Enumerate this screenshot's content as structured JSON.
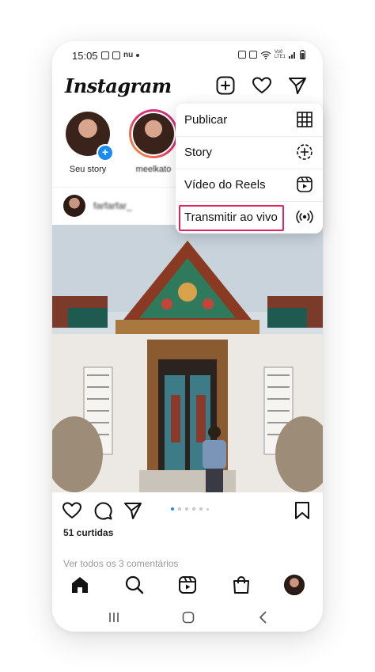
{
  "status_bar": {
    "time": "15:05",
    "carrier": "Vo0 LTE1"
  },
  "header": {
    "logo": "Instagram",
    "icons": [
      "new-post-icon",
      "heart-icon",
      "direct-message-icon"
    ]
  },
  "stories": [
    {
      "label": "Seu story"
    },
    {
      "label": "meelkato"
    }
  ],
  "post": {
    "username": "farfarfar_",
    "likes": "51 curtidas",
    "comments_link": "Ver todos os 3 comentários",
    "carousel": {
      "count": 6,
      "active": 1
    }
  },
  "menu": {
    "items": [
      {
        "label": "Publicar",
        "icon": "grid-icon"
      },
      {
        "label": "Story",
        "icon": "story-add-icon"
      },
      {
        "label": "Vídeo do Reels",
        "icon": "reels-icon"
      },
      {
        "label": "Transmitir ao vivo",
        "icon": "live-broadcast-icon"
      }
    ],
    "highlight_color": "#e0245e"
  },
  "bottom_nav": [
    "home-icon",
    "search-icon",
    "reels-icon",
    "shop-icon",
    "profile-avatar"
  ],
  "colors": {
    "accent": "#1a8cf0",
    "highlight": "#e0245e"
  }
}
